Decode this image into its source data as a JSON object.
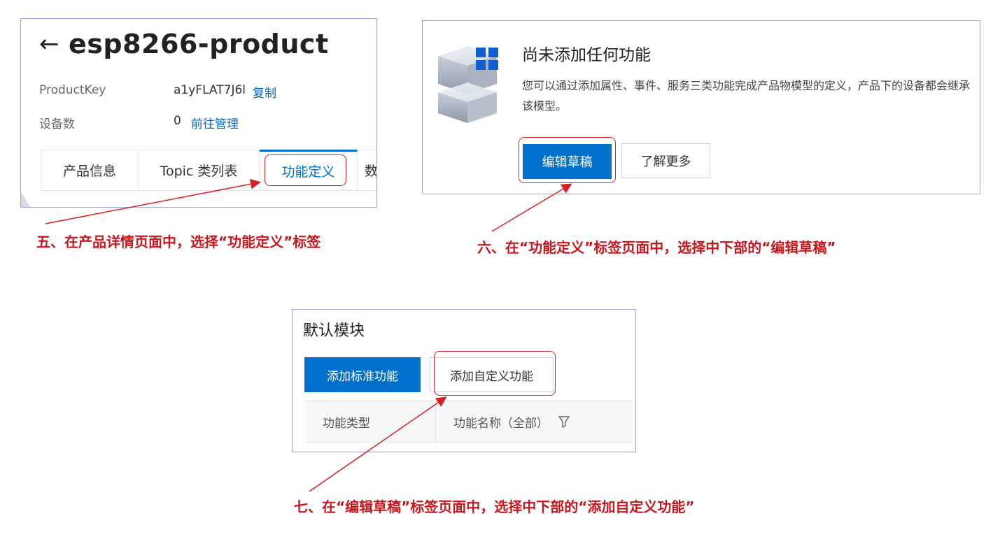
{
  "step5": {
    "back_icon": "←",
    "product_name": "esp8266-product",
    "productkey_label": "ProductKey",
    "productkey_value": "a1yFLAT7J6l",
    "copy_link": "复制",
    "device_count_label": "设备数",
    "device_count_value": "0",
    "manage_link": "前往管理",
    "tabs": [
      {
        "label": "产品信息"
      },
      {
        "label": "Topic 类列表"
      },
      {
        "label": "功能定义"
      },
      {
        "label": "数"
      }
    ],
    "active_tab": "功能定义",
    "caption": "五、在产品详情页面中，选择“功能定义”标签"
  },
  "step6": {
    "heading": "尚未添加任何功能",
    "description": "您可以通过添加属性、事件、服务三类功能完成产品物模型的定义，产品下的设备都会继承该模型。",
    "edit_draft_button": "编辑草稿",
    "learn_more_button": "了解更多",
    "caption": "六、在“功能定义”标签页面中，选择中下部的“编辑草稿”"
  },
  "step7": {
    "heading": "默认模块",
    "add_standard_button": "添加标准功能",
    "add_custom_button": "添加自定义功能",
    "columns": [
      "功能类型",
      "功能名称（全部）"
    ],
    "caption": "七、在“编辑草稿”标签页面中，选择中下部的“添加自定义功能”"
  },
  "colors": {
    "primary": "#0070cc",
    "annotation_red": "#c8161d",
    "panel_border": "#9f9fd6"
  },
  "icons": [
    "arrow-left-icon",
    "product-cube-icon",
    "filter-icon"
  ]
}
